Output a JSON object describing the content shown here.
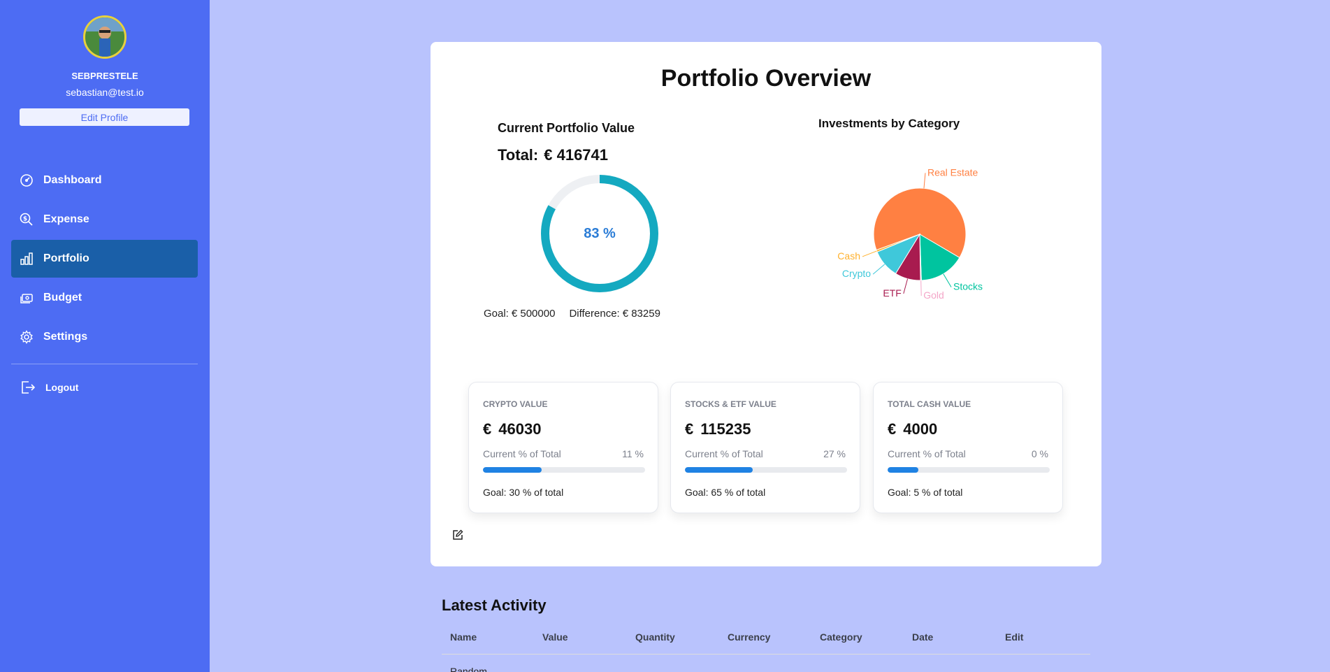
{
  "sidebar": {
    "username": "SEBPRESTELE",
    "email": "sebastian@test.io",
    "edit_profile_label": "Edit Profile",
    "items": [
      {
        "label": "Dashboard",
        "icon": "dashboard-icon"
      },
      {
        "label": "Expense",
        "icon": "expense-icon"
      },
      {
        "label": "Portfolio",
        "icon": "portfolio-icon",
        "active": true
      },
      {
        "label": "Budget",
        "icon": "budget-icon"
      },
      {
        "label": "Settings",
        "icon": "gear-icon"
      }
    ],
    "logout_label": "Logout"
  },
  "overview": {
    "title": "Portfolio Overview",
    "current_value_title": "Current Portfolio Value",
    "total_label": "Total:",
    "total_value": "€ 416741",
    "progress_label": "83 %",
    "progress_fraction": 0.83,
    "goal_label": "Goal:",
    "goal_value": "€ 500000",
    "difference_label": "Difference:",
    "difference_value": "€ 83259",
    "category_title": "Investments by Category"
  },
  "chart_data": {
    "type": "pie",
    "labels": [
      "Real Estate",
      "Stocks",
      "Gold",
      "ETF",
      "Crypto",
      "Cash"
    ],
    "values": [
      64,
      16,
      0.3,
      9,
      10,
      0.7
    ],
    "colors": [
      "#ff8042",
      "#00c49f",
      "#f4a6c8",
      "#a81b4f",
      "#3fc8da",
      "#ffb12e"
    ]
  },
  "stats": [
    {
      "label": "CRYPTO VALUE",
      "currency": "€",
      "value": "46030",
      "pct_label": "Current % of Total",
      "pct": "11 %",
      "fill": 0.36,
      "goal": "Goal: 30 % of total"
    },
    {
      "label": "STOCKS & ETF VALUE",
      "currency": "€",
      "value": "115235",
      "pct_label": "Current % of Total",
      "pct": "27 %",
      "fill": 0.42,
      "goal": "Goal: 65 % of total"
    },
    {
      "label": "TOTAL CASH VALUE",
      "currency": "€",
      "value": "4000",
      "pct_label": "Current % of Total",
      "pct": "0 %",
      "fill": 0.19,
      "goal": "Goal: 5 % of total"
    }
  ],
  "activity": {
    "title": "Latest Activity",
    "columns": [
      "Name",
      "Value",
      "Quantity",
      "Currency",
      "Category",
      "Date",
      "Edit"
    ],
    "first_row_name": "Random"
  },
  "colors": {
    "sidebar": "#4d6cf3",
    "active_nav": "#1a5fa8",
    "background": "#b9c3fd",
    "ring": "#14a9c0",
    "progress_fill": "#1f82e3"
  }
}
